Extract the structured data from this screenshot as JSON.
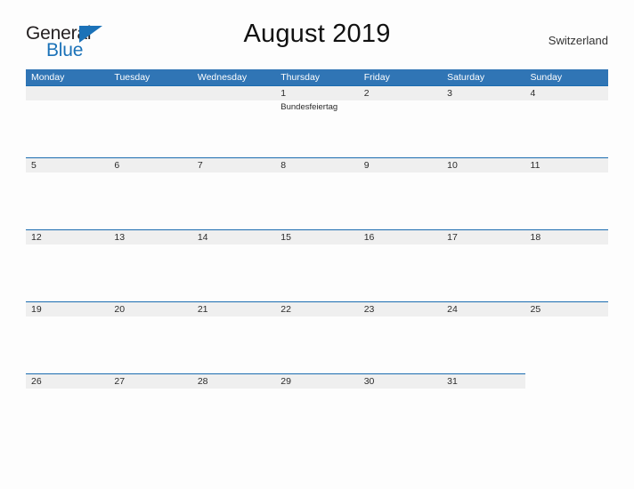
{
  "brand": {
    "name_part1": "General",
    "name_part2": "Blue",
    "triangle_color": "#1b72b8"
  },
  "header": {
    "title": "August 2019",
    "region": "Switzerland"
  },
  "theme": {
    "header_blue": "#3075b5",
    "rule_blue": "#1b6cb0",
    "band_gray": "#efefef"
  },
  "calendar": {
    "day_headers": [
      "Monday",
      "Tuesday",
      "Wednesday",
      "Thursday",
      "Friday",
      "Saturday",
      "Sunday"
    ],
    "weeks": [
      {
        "rule_span": 7,
        "days": [
          {
            "num": "",
            "event": ""
          },
          {
            "num": "",
            "event": ""
          },
          {
            "num": "",
            "event": ""
          },
          {
            "num": "1",
            "event": "Bundesfeiertag"
          },
          {
            "num": "2",
            "event": ""
          },
          {
            "num": "3",
            "event": ""
          },
          {
            "num": "4",
            "event": ""
          }
        ]
      },
      {
        "rule_span": 7,
        "days": [
          {
            "num": "5",
            "event": ""
          },
          {
            "num": "6",
            "event": ""
          },
          {
            "num": "7",
            "event": ""
          },
          {
            "num": "8",
            "event": ""
          },
          {
            "num": "9",
            "event": ""
          },
          {
            "num": "10",
            "event": ""
          },
          {
            "num": "11",
            "event": ""
          }
        ]
      },
      {
        "rule_span": 7,
        "days": [
          {
            "num": "12",
            "event": ""
          },
          {
            "num": "13",
            "event": ""
          },
          {
            "num": "14",
            "event": ""
          },
          {
            "num": "15",
            "event": ""
          },
          {
            "num": "16",
            "event": ""
          },
          {
            "num": "17",
            "event": ""
          },
          {
            "num": "18",
            "event": ""
          }
        ]
      },
      {
        "rule_span": 7,
        "days": [
          {
            "num": "19",
            "event": ""
          },
          {
            "num": "20",
            "event": ""
          },
          {
            "num": "21",
            "event": ""
          },
          {
            "num": "22",
            "event": ""
          },
          {
            "num": "23",
            "event": ""
          },
          {
            "num": "24",
            "event": ""
          },
          {
            "num": "25",
            "event": ""
          }
        ]
      },
      {
        "rule_span": 6,
        "days": [
          {
            "num": "26",
            "event": ""
          },
          {
            "num": "27",
            "event": ""
          },
          {
            "num": "28",
            "event": ""
          },
          {
            "num": "29",
            "event": ""
          },
          {
            "num": "30",
            "event": ""
          },
          {
            "num": "31",
            "event": ""
          },
          {
            "num": "",
            "event": ""
          }
        ]
      }
    ]
  }
}
